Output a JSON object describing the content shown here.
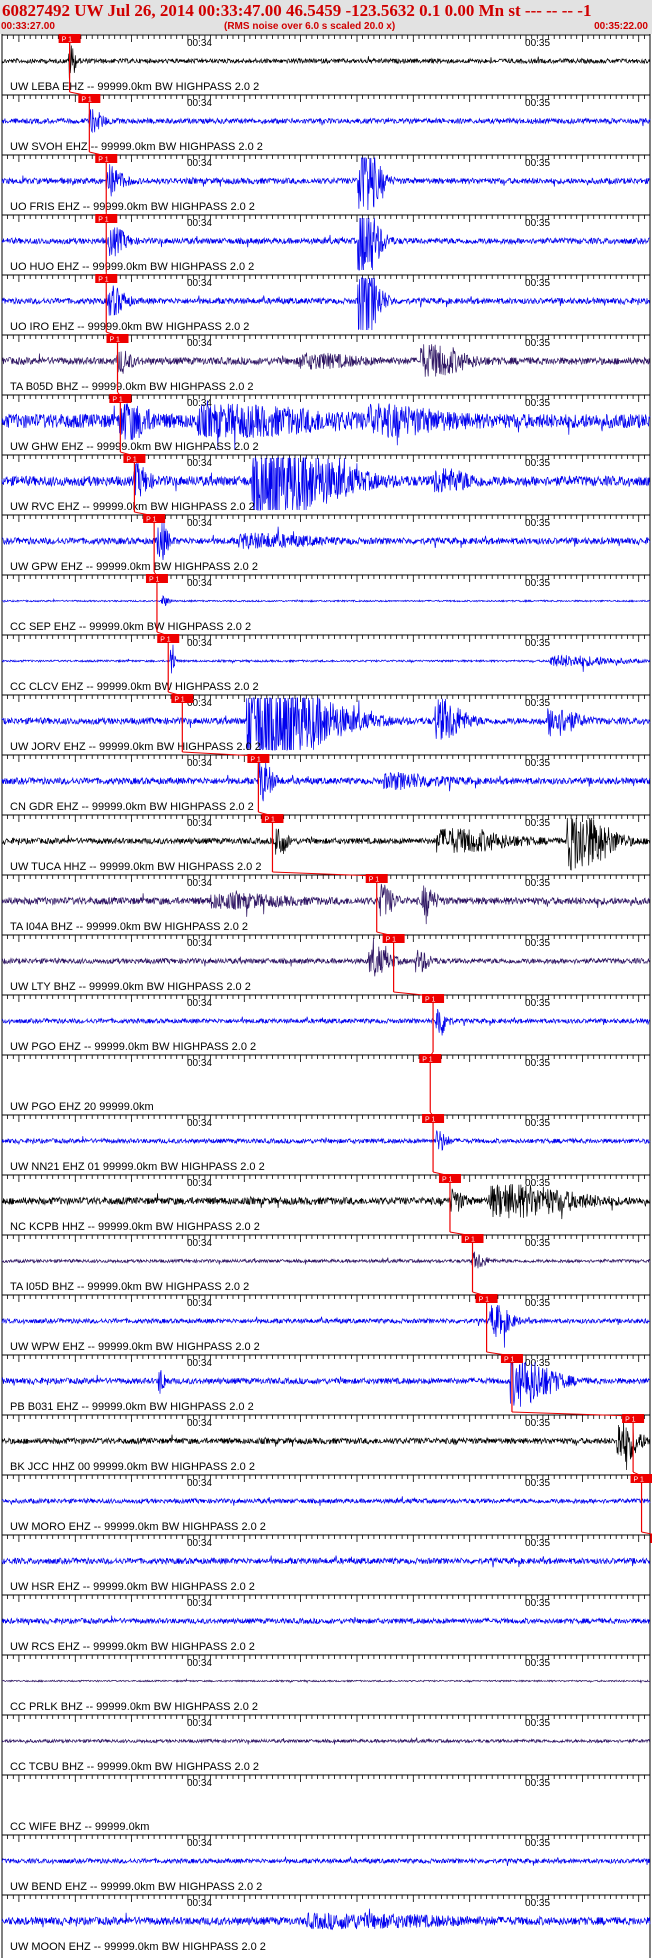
{
  "header": {
    "title": "60827492 UW Jul 26, 2014 00:33:47.00   46.5459 -123.5632  0.1 0.00 Mn st --- -- --  -1",
    "start_time": "00:33:27.00",
    "end_time": "00:35:22.00",
    "scale_note": "(RMS noise over 6.0 s scaled 20.0 x)"
  },
  "colors": {
    "header_bg": "#e2e2e2",
    "header_text": "#d00000",
    "pick": "#ee0000",
    "blue": "#0000ee",
    "black": "#000000",
    "purple": "#2e1563"
  },
  "chart_data": {
    "type": "line",
    "x_range_seconds": [
      0,
      115
    ],
    "tick_spacing_seconds": 1,
    "time_labels": [
      {
        "t": 33,
        "label": "00:34"
      },
      {
        "t": 93,
        "label": "00:35"
      }
    ],
    "pick_label": "P 1",
    "traces": [
      {
        "label": "UW LEBA EHZ -- 99999.0km BW  HIGHPASS  2.0  2",
        "color": "black",
        "amp": 0.35,
        "pick": 12.0,
        "bursts": [
          {
            "t": 12.0,
            "w": 1.0,
            "a": 3.0
          }
        ]
      },
      {
        "label": "UW SVOH EHZ -- 99999.0km BW  HIGHPASS  2.0  2",
        "color": "blue",
        "amp": 0.4,
        "pick": 15.5,
        "bursts": [
          {
            "t": 16.0,
            "w": 2.0,
            "a": 1.5
          }
        ]
      },
      {
        "label": "UO FRIS EHZ -- 99999.0km BW  HIGHPASS  2.0  2",
        "color": "blue",
        "amp": 0.45,
        "pick": 18.5,
        "bursts": [
          {
            "t": 19.0,
            "w": 2.5,
            "a": 2.0
          },
          {
            "t": 64.0,
            "w": 3.0,
            "a": 6.0
          }
        ]
      },
      {
        "label": "UO HUO EHZ -- 99999.0km BW  HIGHPASS  2.0  2",
        "color": "blue",
        "amp": 0.45,
        "pick": 18.5,
        "bursts": [
          {
            "t": 19.5,
            "w": 2.5,
            "a": 2.0
          },
          {
            "t": 64.0,
            "w": 3.0,
            "a": 6.0
          }
        ]
      },
      {
        "label": "UO IRO EHZ -- 99999.0km BW  HIGHPASS  2.0  2",
        "color": "blue",
        "amp": 0.45,
        "pick": 18.5,
        "bursts": [
          {
            "t": 19.5,
            "w": 2.5,
            "a": 2.0
          },
          {
            "t": 64.0,
            "w": 3.0,
            "a": 6.0
          }
        ]
      },
      {
        "label": "TA B05D BHZ -- 99999.0km BW  HIGHPASS  2.0  2",
        "color": "purple",
        "amp": 0.55,
        "pick": 20.5,
        "bursts": [
          {
            "t": 21.0,
            "w": 2.0,
            "a": 1.5
          },
          {
            "t": 76.0,
            "w": 6.0,
            "a": 2.2
          },
          {
            "t": 55.0,
            "w": 8.0,
            "a": 0.8
          }
        ]
      },
      {
        "label": "UW GHW EHZ -- 99999.0km BW  HIGHPASS  2.0  2",
        "color": "blue",
        "amp": 1.1,
        "pick": 21.0,
        "bursts": [
          {
            "t": 22.0,
            "w": 4.0,
            "a": 2.2
          },
          {
            "t": 40.0,
            "w": 18.0,
            "a": 1.6
          },
          {
            "t": 68.0,
            "w": 10.0,
            "a": 1.5
          }
        ]
      },
      {
        "label": "UW RVC EHZ -- 99999.0km BW  HIGHPASS  2.0  2",
        "color": "blue",
        "amp": 0.75,
        "pick": 23.5,
        "bursts": [
          {
            "t": 48.0,
            "w": 12.0,
            "a": 5.5
          },
          {
            "t": 24.0,
            "w": 2.0,
            "a": 2.0
          },
          {
            "t": 78.0,
            "w": 5.0,
            "a": 1.4
          }
        ]
      },
      {
        "label": "UW GPW EHZ -- 99999.0km BW  HIGHPASS  2.0  2",
        "color": "blue",
        "amp": 0.5,
        "pick": 27.0,
        "bursts": [
          {
            "t": 28.0,
            "w": 1.5,
            "a": 3.0
          },
          {
            "t": 45.0,
            "w": 10.0,
            "a": 0.8
          }
        ]
      },
      {
        "label": "CC SEP EHZ -- 99999.0km BW  HIGHPASS  2.0  2",
        "color": "blue",
        "amp": 0.12,
        "pick": 27.5,
        "bursts": [
          {
            "t": 28.5,
            "w": 1.2,
            "a": 0.8
          }
        ]
      },
      {
        "label": "CC CLCV EHZ -- 99999.0km BW  HIGHPASS  2.0  2",
        "color": "blue",
        "amp": 0.15,
        "pick": 29.5,
        "bursts": [
          {
            "t": 30.0,
            "w": 0.6,
            "a": 4.0
          },
          {
            "t": 100.0,
            "w": 10.0,
            "a": 0.8
          }
        ]
      },
      {
        "label": "UW JORV EHZ -- 99999.0km BW  HIGHPASS  2.0  2",
        "color": "blue",
        "amp": 0.5,
        "pick": 32.0,
        "bursts": [
          {
            "t": 47.0,
            "w": 12.0,
            "a": 6.5
          },
          {
            "t": 78.0,
            "w": 4.0,
            "a": 3.0
          },
          {
            "t": 98.0,
            "w": 4.0,
            "a": 2.0
          }
        ]
      },
      {
        "label": "CN GDR EHZ -- 99999.0km BW  HIGHPASS  2.0  2",
        "color": "blue",
        "amp": 0.5,
        "pick": 45.5,
        "bursts": [
          {
            "t": 46.0,
            "w": 2.0,
            "a": 3.0
          },
          {
            "t": 70.0,
            "w": 8.0,
            "a": 0.9
          }
        ]
      },
      {
        "label": "UW TUCA HHZ -- 99999.0km BW  HIGHPASS  2.0  2",
        "color": "black",
        "amp": 0.45,
        "pick": 48.0,
        "bursts": [
          {
            "t": 49.0,
            "w": 1.5,
            "a": 2.5
          },
          {
            "t": 102.0,
            "w": 6.0,
            "a": 4.5
          },
          {
            "t": 80.0,
            "w": 10.0,
            "a": 1.6
          }
        ]
      },
      {
        "label": "TA I04A BHZ -- 99999.0km BW  HIGHPASS  2.0  2",
        "color": "purple",
        "amp": 0.55,
        "pick": 66.5,
        "bursts": [
          {
            "t": 67.5,
            "w": 2.0,
            "a": 2.2
          },
          {
            "t": 75.0,
            "w": 2.0,
            "a": 2.0
          },
          {
            "t": 40.0,
            "w": 10.0,
            "a": 0.8
          }
        ]
      },
      {
        "label": "UW LTY BHZ -- 99999.0km BW  HIGHPASS  2.0  2",
        "color": "purple",
        "amp": 0.4,
        "pick": 69.5,
        "bursts": [
          {
            "t": 66.0,
            "w": 3.0,
            "a": 2.0
          },
          {
            "t": 74.0,
            "w": 2.0,
            "a": 1.5
          }
        ]
      },
      {
        "label": "UW PGO EHZ -- 99999.0km BW  HIGHPASS  2.0  2",
        "color": "blue",
        "amp": 0.35,
        "pick": 76.5,
        "bursts": [
          {
            "t": 77.5,
            "w": 1.5,
            "a": 2.5
          }
        ]
      },
      {
        "label": "UW PGO EHZ 20 99999.0km",
        "color": "blue",
        "amp": 0.0,
        "pick": 76.0,
        "bursts": []
      },
      {
        "label": "UW NN21 EHZ 01 99999.0km BW  HIGHPASS  2.0  2",
        "color": "blue",
        "amp": 0.35,
        "pick": 76.5,
        "bursts": [
          {
            "t": 77.5,
            "w": 1.5,
            "a": 1.5
          }
        ]
      },
      {
        "label": "NC KCPB HHZ -- 99999.0km BW  HIGHPASS  2.0  2",
        "color": "black",
        "amp": 0.55,
        "pick": 79.5,
        "bursts": [
          {
            "t": 90.0,
            "w": 12.0,
            "a": 2.2
          },
          {
            "t": 80.0,
            "w": 2.0,
            "a": 1.5
          }
        ]
      },
      {
        "label": "TA I05D BHZ -- 99999.0km BW  HIGHPASS  2.0  2",
        "color": "purple",
        "amp": 0.25,
        "pick": 83.5,
        "bursts": [
          {
            "t": 84.0,
            "w": 2.0,
            "a": 1.2
          }
        ]
      },
      {
        "label": "UW WPW EHZ -- 99999.0km BW  HIGHPASS  2.0  2",
        "color": "blue",
        "amp": 0.35,
        "pick": 86.0,
        "bursts": [
          {
            "t": 87.5,
            "w": 3.0,
            "a": 2.2
          }
        ]
      },
      {
        "label": "PB B031 EHZ -- 99999.0km BW  HIGHPASS  2.0  2",
        "color": "blue",
        "amp": 0.45,
        "pick": 90.5,
        "bursts": [
          {
            "t": 92.0,
            "w": 6.0,
            "a": 3.5
          },
          {
            "t": 28.0,
            "w": 1.0,
            "a": 1.8
          }
        ]
      },
      {
        "label": "BK JCC HHZ 00 99999.0km BW  HIGHPASS  2.0  2",
        "color": "black",
        "amp": 0.45,
        "pick": 112.0,
        "bursts": [
          {
            "t": 110.0,
            "w": 3.0,
            "a": 3.2
          }
        ]
      },
      {
        "label": "UW MORO EHZ -- 99999.0km BW  HIGHPASS  2.0  2",
        "color": "blue",
        "amp": 0.35,
        "pick": 113.5,
        "bursts": []
      },
      {
        "label": "UW HSR EHZ -- 99999.0km BW  HIGHPASS  2.0  2",
        "color": "blue",
        "amp": 0.45,
        "pick": 117.0,
        "bursts": []
      },
      {
        "label": "UW RCS EHZ -- 99999.0km BW  HIGHPASS  2.0  2",
        "color": "blue",
        "amp": 0.4,
        "pick": 120.0,
        "bursts": [
          {
            "t": 126.5,
            "w": 0.7,
            "a": 3.0
          }
        ]
      },
      {
        "label": "CC PRLK BHZ -- 99999.0km BW  HIGHPASS  2.0  2",
        "color": "purple",
        "amp": 0.12,
        "pick": null,
        "bursts": []
      },
      {
        "label": "CC TCBU BHZ -- 99999.0km BW  HIGHPASS  2.0  2",
        "color": "purple",
        "amp": 0.25,
        "pick": null,
        "bursts": []
      },
      {
        "label": "CC WIFE BHZ -- 99999.0km",
        "color": "blue",
        "amp": 0.0,
        "pick": null,
        "bursts": []
      },
      {
        "label": "UW BEND EHZ -- 99999.0km BW  HIGHPASS  2.0  2",
        "color": "blue",
        "amp": 0.35,
        "pick": null,
        "bursts": []
      },
      {
        "label": "UW MOON EHZ -- 99999.0km BW  HIGHPASS  2.0  2",
        "color": "blue",
        "amp": 0.6,
        "pick": null,
        "bursts": [
          {
            "t": 60.0,
            "w": 20.0,
            "a": 0.7
          }
        ]
      }
    ]
  }
}
